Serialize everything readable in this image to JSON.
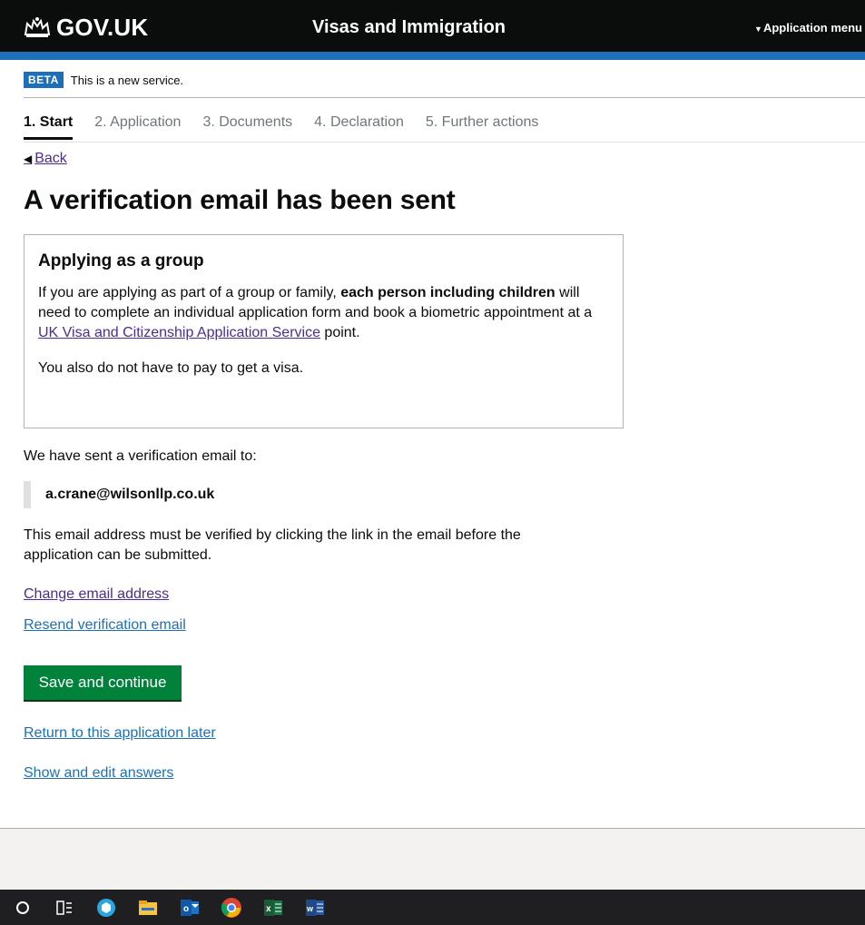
{
  "header": {
    "logo_text": "GOV.UK",
    "service_name": "Visas and Immigration",
    "app_menu_label": "Application menu"
  },
  "beta": {
    "tag": "BETA",
    "text": "This is a new service."
  },
  "steps": [
    {
      "label": "1. Start",
      "active": true
    },
    {
      "label": "2. Application",
      "active": false
    },
    {
      "label": "3. Documents",
      "active": false
    },
    {
      "label": "4. Declaration",
      "active": false
    },
    {
      "label": "5. Further actions",
      "active": false
    }
  ],
  "back_label": "Back",
  "page_title": "A verification email has been sent",
  "inset": {
    "heading": "Applying as a group",
    "p1_start": "If you are applying as part of a group or family, ",
    "p1_bold": "each person including children",
    "p1_mid": " will need to complete an individual application form and book a biometric appointment at a ",
    "p1_link": "UK Visa and Citizenship Application Service",
    "p1_end": " point.",
    "p2": "You also do not have to pay to get a visa."
  },
  "sent_text": "We have sent a verification email to:",
  "email": "a.crane@wilsonllp.co.uk",
  "verify_text": "This email address must be verified by clicking the link in the email before the application can be submitted.",
  "links": {
    "change_email": "Change email address",
    "resend": "Resend verification email",
    "return_later": "Return to this application later",
    "show_edit": "Show and edit answers"
  },
  "save_button": "Save and continue",
  "colors": {
    "header_bg": "#0b0c0c",
    "brand_blue": "#1d70b8",
    "button_green": "#00823b",
    "visited_link": "#4c2c92"
  },
  "taskbar_icons": [
    "cortana-icon",
    "task-view-icon",
    "app-icon",
    "file-explorer-icon",
    "outlook-icon",
    "chrome-icon",
    "excel-icon",
    "word-icon"
  ]
}
